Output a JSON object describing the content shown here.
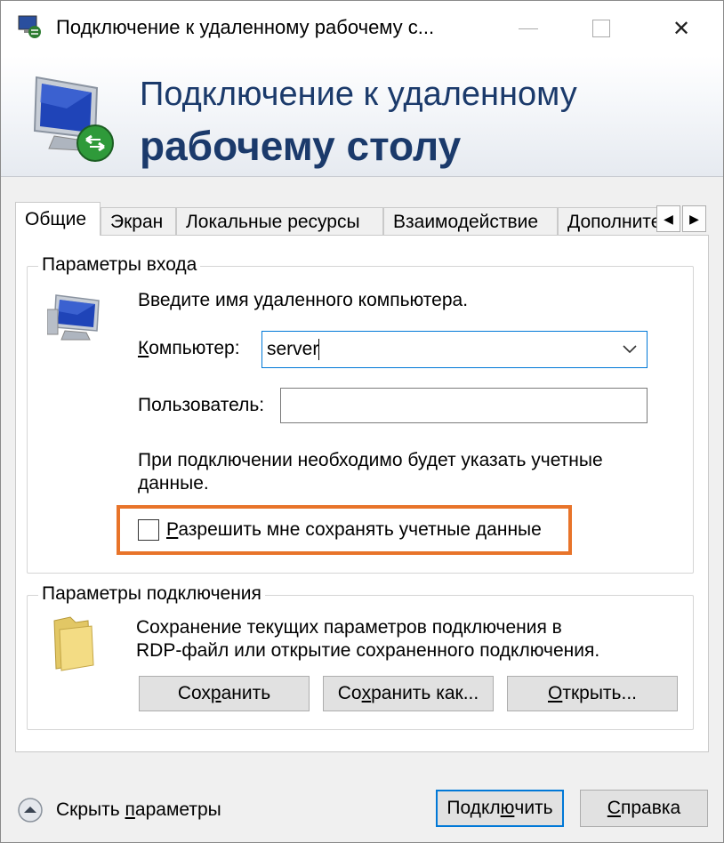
{
  "window": {
    "title": "Подключение к удаленному рабочему с...",
    "close_glyph": "✕"
  },
  "banner": {
    "line1": "Подключение к удаленному",
    "line2": "рабочему столу"
  },
  "tabs": [
    {
      "label": "Общие",
      "active": true
    },
    {
      "label": "Экран"
    },
    {
      "label": "Локальные ресурсы"
    },
    {
      "label": "Взаимодействие"
    },
    {
      "label": "Дополнительно"
    }
  ],
  "tab_scroll": {
    "left": "◀",
    "right": "▶"
  },
  "login_group": {
    "legend": "Параметры входа",
    "instruction": "Введите имя удаленного компьютера.",
    "computer_label_prefix": "",
    "computer_label_accel": "К",
    "computer_label_rest": "омпьютер:",
    "computer_value": "server",
    "user_label": "Пользователь:",
    "user_value": "",
    "note_line1": "При подключении необходимо будет указать учетные",
    "note_line2": "данные.",
    "save_creds_accel": "Р",
    "save_creds_rest": "азрешить мне сохранять учетные данные",
    "save_creds_checked": false
  },
  "conn_group": {
    "legend": "Параметры подключения",
    "desc_line1": "Сохранение текущих параметров подключения в",
    "desc_line2": "RDP-файл или открытие сохраненного подключения.",
    "save_pre": "Сох",
    "save_accel": "р",
    "save_post": "анить",
    "save_as_pre": "Со",
    "save_as_accel": "х",
    "save_as_post": "ранить как...",
    "open_accel": "О",
    "open_post": "ткрыть..."
  },
  "footer": {
    "hide_pre": "Скрыть ",
    "hide_accel": "п",
    "hide_post": "араметры",
    "connect_pre": "Подкл",
    "connect_accel": "ю",
    "connect_post": "чить",
    "help_accel": "С",
    "help_post": "правка"
  },
  "colors": {
    "banner_text": "#1b3a6b",
    "highlight": "#e8742a",
    "focus": "#0078d7"
  }
}
